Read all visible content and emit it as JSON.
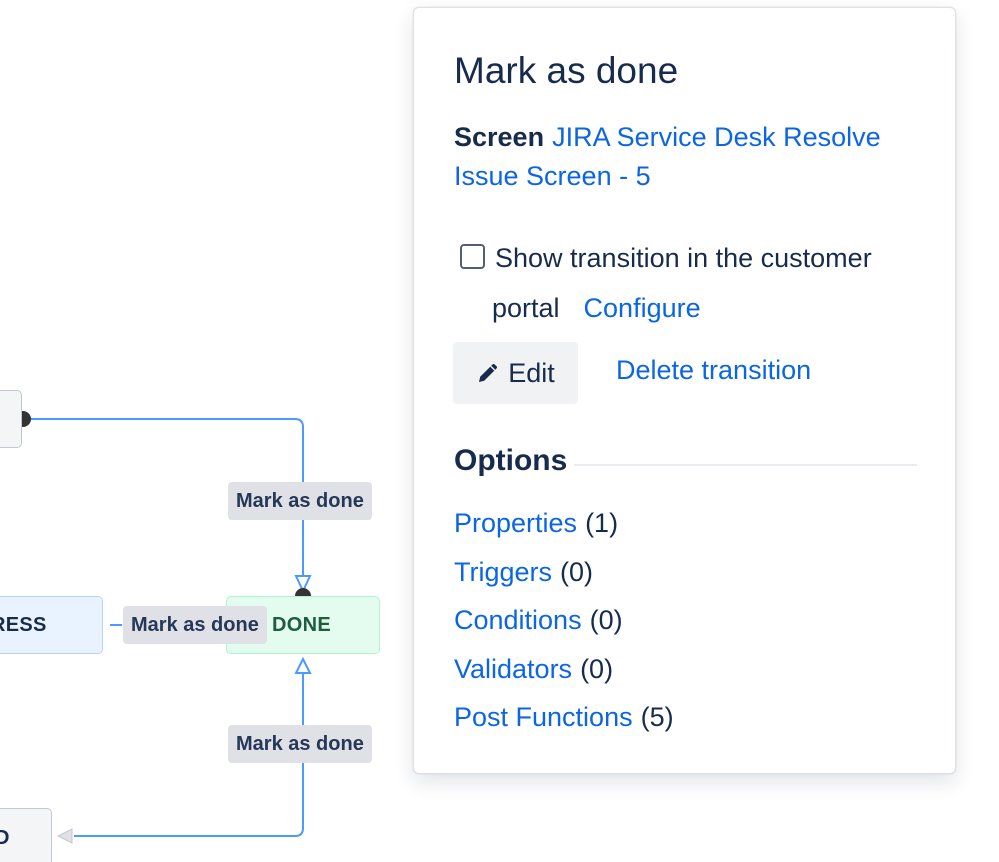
{
  "diagram": {
    "statuses": {
      "in_progress_partial": "RESS",
      "done": "DONE",
      "bottom_partial": "D"
    },
    "transitions": [
      {
        "label": "Mark as done"
      },
      {
        "label": "Mark as done"
      },
      {
        "label": "Mark as done"
      }
    ]
  },
  "panel": {
    "title": "Mark as done",
    "screen_label": "Screen",
    "screen_link": "JIRA Service Desk Resolve Issue Screen - 5",
    "portal_checkbox_label_line1": "Show transition in the customer",
    "portal_checkbox_label_line2": "portal",
    "portal_checked": false,
    "configure_link": "Configure",
    "edit_button_label": "Edit",
    "edit_icon": "pencil-icon",
    "delete_link": "Delete transition",
    "options_heading": "Options",
    "options": [
      {
        "label": "Properties",
        "count": "(1)"
      },
      {
        "label": "Triggers",
        "count": "(0)"
      },
      {
        "label": "Conditions",
        "count": "(0)"
      },
      {
        "label": "Validators",
        "count": "(0)"
      },
      {
        "label": "Post Functions",
        "count": "(5)"
      }
    ]
  },
  "colors": {
    "link": "#0c66e4",
    "text": "#172b4d",
    "connector": "#4c9aff",
    "done_bg": "#e3fcef",
    "in_progress_bg": "#e9f2ff",
    "label_bg": "#dfe1e6"
  }
}
